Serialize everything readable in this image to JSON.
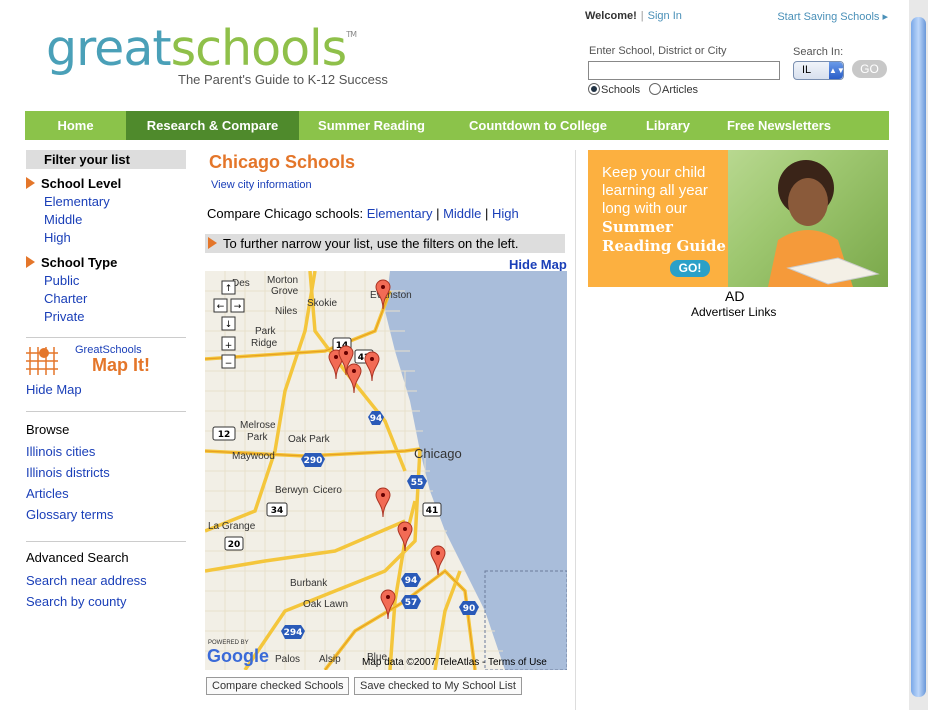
{
  "header": {
    "logo_great": "great",
    "logo_schools": "schools",
    "logo_tm": "TM",
    "tagline": "The Parent's Guide to K-12 Success",
    "welcome": "Welcome!",
    "sign_in": "Sign In",
    "start_saving": "Start Saving Schools ▸",
    "search_label": "Enter School, District or City",
    "search_value": "",
    "search_in_label": "Search In:",
    "state_value": "IL",
    "go_label": "GO",
    "radio_schools": "Schools",
    "radio_articles": "Articles"
  },
  "nav": [
    {
      "label": "Home"
    },
    {
      "label": "Research & Compare"
    },
    {
      "label": "Summer Reading"
    },
    {
      "label": "Countdown to College"
    },
    {
      "label": "Library"
    },
    {
      "label": "Free Newsletters"
    }
  ],
  "sidebar": {
    "filter_head": "Filter your list",
    "school_level_title": "School Level",
    "school_levels": [
      "Elementary",
      "Middle",
      "High"
    ],
    "school_type_title": "School Type",
    "school_types": [
      "Public",
      "Charter",
      "Private"
    ],
    "mapit_brand": "GreatSchools",
    "mapit_label": "Map It!",
    "hide_map": "Hide Map",
    "browse_title": "Browse",
    "browse_links": [
      "Illinois cities",
      "Illinois districts",
      "Articles",
      "Glossary terms"
    ],
    "advanced_title": "Advanced Search",
    "advanced_links": [
      "Search near address",
      "Search by county"
    ]
  },
  "main": {
    "title": "Chicago Schools",
    "city_info": "View city information",
    "compare_prefix": "Compare  Chicago schools:",
    "compare_links": [
      "Elementary",
      "Middle",
      "High"
    ],
    "narrow_text": "To further narrow your list, use the filters on the left.",
    "hide_map": "Hide Map",
    "map_labels": [
      "Morton Grove",
      "Skokie",
      "Evanston",
      "Niles",
      "Park Ridge",
      "Des",
      "Melrose Park",
      "Oak Park",
      "Maywood",
      "Chicago",
      "Berwyn",
      "Cicero",
      "La Grange",
      "Burbank",
      "Oak Lawn",
      "Palos",
      "Alsip",
      "Blue"
    ],
    "highway_labels": [
      "14",
      "42",
      "94",
      "12",
      "290",
      "55",
      "41",
      "34",
      "20",
      "94",
      "57",
      "90",
      "294"
    ],
    "map_attribution": "Map data ©2007 TeleAtlas - Terms of Use",
    "powered_by": "POWERED BY",
    "google": "Google",
    "btn_compare": "Compare checked Schools",
    "btn_save": "Save checked to My School List"
  },
  "ad": {
    "text_line": "Keep your child learning all year long with our",
    "text_bold": "Summer Reading Guide",
    "go": "GO!",
    "label": "AD",
    "advertiser": "Advertiser Links"
  },
  "colors": {
    "nav_green": "#8bc34a",
    "nav_active": "#4f8a2c",
    "title_orange": "#e4762a",
    "link_blue": "#1a3fb8",
    "ad_orange": "#fcb040"
  }
}
